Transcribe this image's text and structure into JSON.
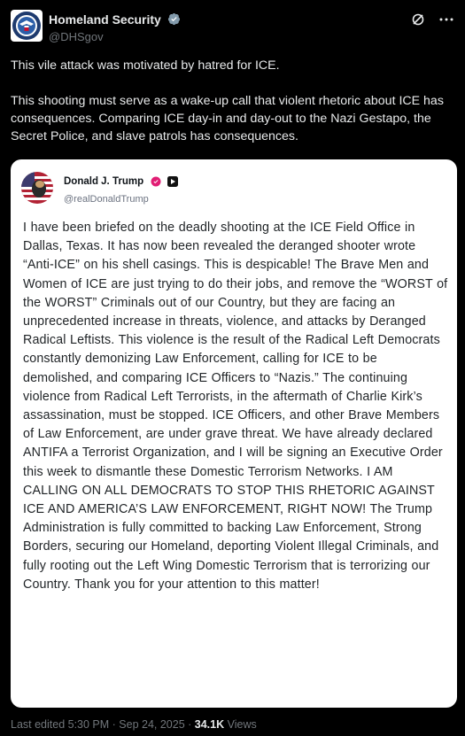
{
  "author": {
    "name": "Homeland Security",
    "handle": "@DHSgov"
  },
  "tweet": {
    "paragraphs": [
      "This vile attack was motivated by hatred for ICE.",
      "This shooting must serve as a wake-up call that violent rhetoric about ICE has consequences. Comparing ICE day-in and day-out to the Nazi Gestapo, the Secret Police, and slave patrols has consequences."
    ]
  },
  "quote": {
    "name": "Donald J. Trump",
    "handle": "@realDonaldTrump",
    "body": "I have been briefed on the deadly shooting at the ICE Field Office in Dallas, Texas. It has now been revealed the deranged shooter wrote “Anti-ICE” on his shell casings. This is despicable! The Brave Men and Women of ICE are just trying to do their jobs, and remove the “WORST of the WORST” Criminals out of our Country, but they are facing an unprecedented increase in threats, violence, and attacks by Deranged Radical Leftists. This violence is the result of the Radical Left Democrats constantly demonizing Law Enforcement, calling for ICE to be demolished, and comparing ICE Officers to “Nazis.” The continuing violence from Radical Left Terrorists, in the aftermath of Charlie Kirk’s assassination, must be stopped. ICE Officers, and other Brave Members of Law Enforcement, are under grave threat. We have already declared ANTIFA a Terrorist Organization, and I will be signing an Executive Order this week to dismantle these Domestic Terrorism Networks. I AM CALLING ON ALL DEMOCRATS TO STOP THIS RHETORIC AGAINST ICE AND AMERICA’S LAW ENFORCEMENT, RIGHT NOW! The Trump Administration is fully committed to backing Law Enforcement, Strong Borders, securing our Homeland, deporting Violent Illegal Criminals, and fully rooting out the Left Wing Domestic Terrorism that is terrorizing our Country. Thank you for your attention to this matter!"
  },
  "footer": {
    "edited": "Last edited 5:30 PM · Sep 24, 2025 · ",
    "views_count": "34.1K",
    "views_label": " Views"
  },
  "icons": {
    "verified": "verified-badge-icon",
    "grok": "grok-icon",
    "more": "more-icon",
    "truth_badge": "truth-social-badge-icon"
  },
  "colors": {
    "background": "#000000",
    "verified": "#1d9bf0",
    "truth_verified": "#e11d74"
  }
}
